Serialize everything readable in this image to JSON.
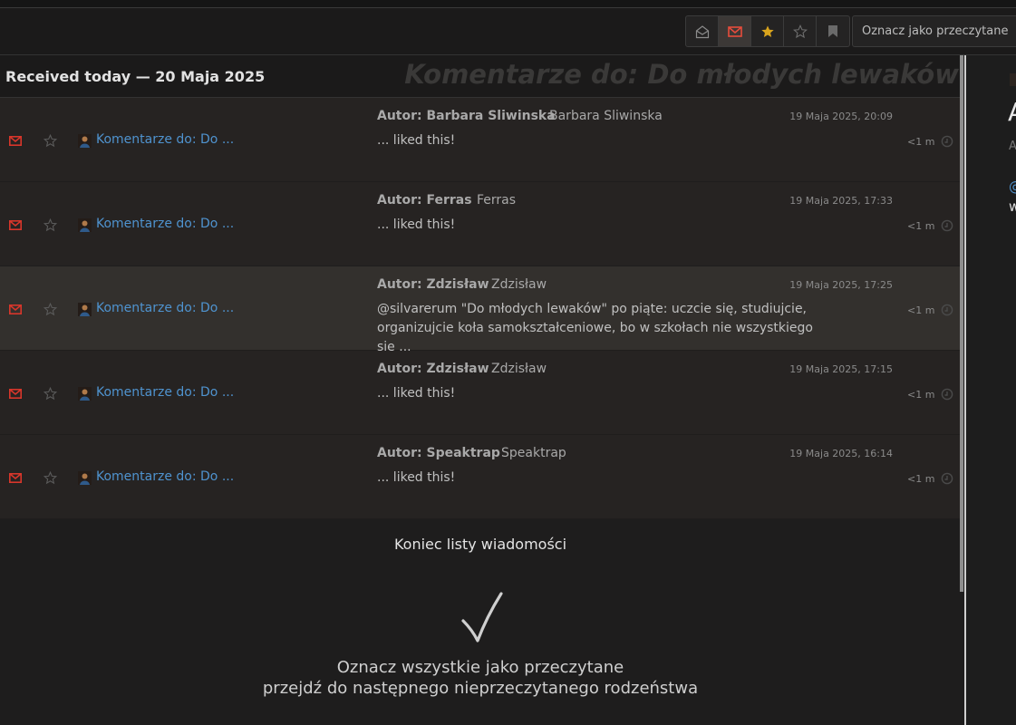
{
  "toolbar": {
    "filters": [
      {
        "name": "read-envelope",
        "active": false
      },
      {
        "name": "unread-envelope",
        "active": true
      },
      {
        "name": "starred",
        "active": false
      },
      {
        "name": "unstarred",
        "active": false
      },
      {
        "name": "bookmark",
        "active": false
      }
    ],
    "mark_read_label": "Oznacz jako przeczytane"
  },
  "list": {
    "group_title": "Received today — 20 Maja 2025",
    "thread_title": "Komentarze do: Do młodych lewaków",
    "rows": [
      {
        "link": "Komentarze do: Do ...",
        "author": "Autor: Barbara Sliwinska",
        "name": "Barbara Sliwinska",
        "date": "19 Maja 2025, 20:09",
        "snippet": "... liked this!",
        "age": "<1 m"
      },
      {
        "link": "Komentarze do: Do ...",
        "author": "Autor: Ferras",
        "name": "Ferras",
        "date": "19 Maja 2025, 17:33",
        "snippet": "... liked this!",
        "age": "<1 m"
      },
      {
        "link": "Komentarze do: Do ...",
        "author": "Autor: Zdzisław",
        "name": "Zdzisław",
        "date": "19 Maja 2025, 17:25",
        "snippet": "@silvarerum \"Do młodych lewaków\" po piąte: uczcie się, studiujcie, organizujcie koła samokształceniowe, bo w szkołach nie wszystkiego się ...",
        "age": "<1 m"
      },
      {
        "link": "Komentarze do: Do ...",
        "author": "Autor: Zdzisław",
        "name": "Zdzisław",
        "date": "19 Maja 2025, 17:15",
        "snippet": "... liked this!",
        "age": "<1 m"
      },
      {
        "link": "Komentarze do: Do ...",
        "author": "Autor: Speaktrap",
        "name": "Speaktrap",
        "date": "19 Maja 2025, 16:14",
        "snippet": "... liked this!",
        "age": "<1 m"
      }
    ]
  },
  "footer": {
    "end_label": "Koniec listy wiadomości",
    "checkmark": "✓",
    "action_mark_all": "Oznacz wszystkie jako przeczytane",
    "action_next_sibling": "przejdź do następnego nieprzeczytanego rodzeństwa"
  },
  "sidepane": {
    "big_text": "A",
    "small_text": "A",
    "link_text": "@",
    "text": "w"
  },
  "colors": {
    "accent_red": "#d8362b",
    "link_blue": "#4f93cf",
    "star_gold": "#d9a41d",
    "background": "#1e1d1d"
  }
}
